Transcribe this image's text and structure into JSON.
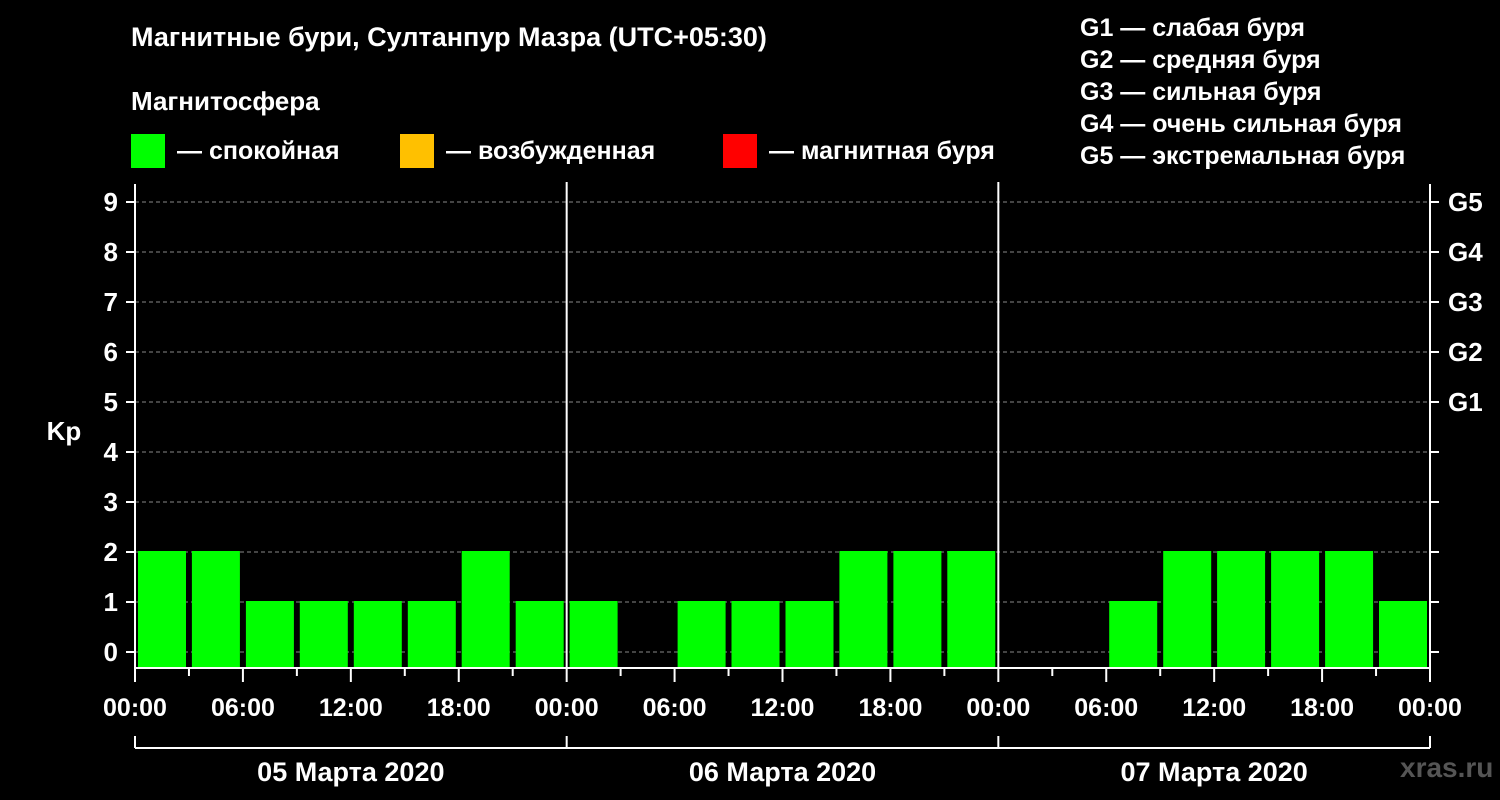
{
  "chart_data": {
    "type": "bar",
    "title": "Магнитные бури, Султанпур Мазра (UTC+05:30)",
    "subtitle": "Магнитосфера",
    "ylabel": "Kp",
    "ylim": [
      0,
      9
    ],
    "yticks": [
      "0",
      "1",
      "2",
      "3",
      "4",
      "5",
      "6",
      "7",
      "8",
      "9"
    ],
    "right_axis_labels": [
      {
        "kp": 5,
        "label": "G1"
      },
      {
        "kp": 6,
        "label": "G2"
      },
      {
        "kp": 7,
        "label": "G3"
      },
      {
        "kp": 8,
        "label": "G4"
      },
      {
        "kp": 9,
        "label": "G5"
      }
    ],
    "legend": [
      {
        "label": "— спокойная",
        "color": "#00ff00"
      },
      {
        "label": "— возбужденная",
        "color": "#ffc000"
      },
      {
        "label": "— магнитная буря",
        "color": "#ff0000"
      }
    ],
    "g_legend": [
      "G1 — слабая буря",
      "G2 — средняя буря",
      "G3 — сильная буря",
      "G4 — очень сильная буря",
      "G5 — экстремальная буря"
    ],
    "days": [
      "05 Марта 2020",
      "06 Марта 2020",
      "07 Марта 2020"
    ],
    "hour_tick_labels": [
      "00:00",
      "06:00",
      "12:00",
      "18:00"
    ],
    "final_tick_label": "00:00",
    "interval_hours": 3,
    "values": [
      [
        2,
        2,
        1,
        1,
        1,
        1,
        2,
        1
      ],
      [
        1,
        null,
        1,
        1,
        1,
        2,
        2,
        2
      ],
      [
        null,
        null,
        1,
        2,
        2,
        2,
        2,
        1
      ]
    ]
  },
  "watermark": "xras.ru"
}
